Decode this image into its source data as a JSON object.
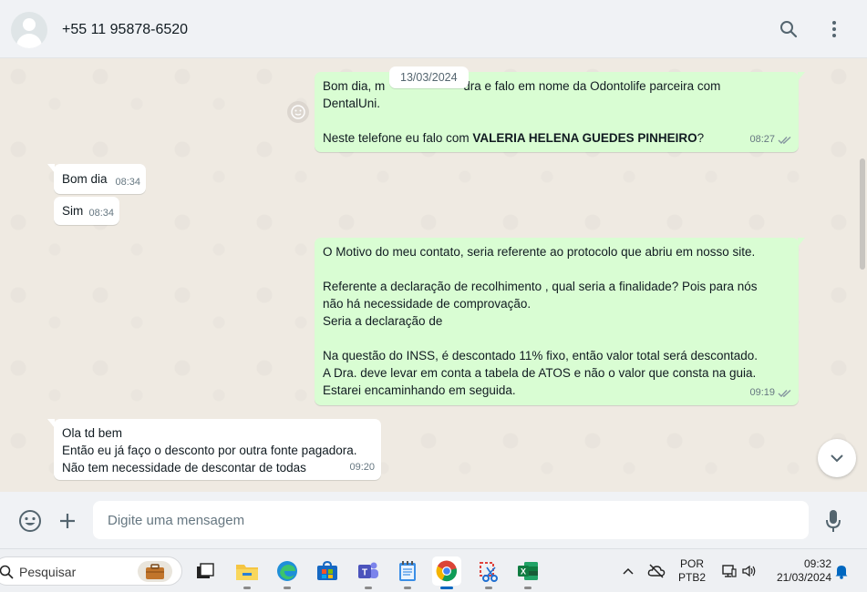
{
  "header": {
    "contact": "+55 11 95878-6520",
    "search_icon": "search-icon",
    "menu_icon": "kebab-menu-icon"
  },
  "chat": {
    "date_chip": "13/03/2024",
    "messages": [
      {
        "dir": "out",
        "line1": "Bom dia, m",
        "line1b": "dra e falo em nome da Odontolife parceira com",
        "line2": "DentalUni.",
        "line3_pre": "Neste telefone eu falo com ",
        "line3_bold": "VALERIA HELENA GUEDES PINHEIRO",
        "line3_post": "?",
        "time": "08:27"
      },
      {
        "dir": "in",
        "text": "Bom dia",
        "time": "08:34"
      },
      {
        "dir": "in",
        "text": "Sim",
        "time": "08:34"
      },
      {
        "dir": "out",
        "lines": [
          "O Motivo do meu contato, seria referente ao protocolo que abriu em nosso site.",
          "",
          "Referente a declaração de recolhimento , qual seria a finalidade? Pois para nós",
          "não há necessidade de comprovação.",
          "Seria a declaração de",
          "",
          "Na questão do INSS, é descontado 11%  fixo, então valor total será descontado.",
          "A Dra. deve levar em conta a tabela de ATOS e não o valor que consta na guia.",
          "Estarei encaminhando em seguida."
        ],
        "time": "09:19"
      },
      {
        "dir": "in",
        "lines": [
          "Ola td bem",
          "Então eu já faço o desconto por outra fonte pagadora.",
          "Não tem necessidade de descontar de todas"
        ],
        "time": "09:20"
      }
    ]
  },
  "composer": {
    "placeholder": "Digite uma mensagem"
  },
  "taskbar": {
    "search_label": "Pesquisar",
    "lang_line1": "POR",
    "lang_line2": "PTB2",
    "time": "09:32",
    "date": "21/03/2024"
  },
  "colors": {
    "outgoing_bubble": "#d9fdd3",
    "incoming_bubble": "#ffffff",
    "chat_bg": "#efeae2",
    "read_ticks": "#8696a0"
  }
}
